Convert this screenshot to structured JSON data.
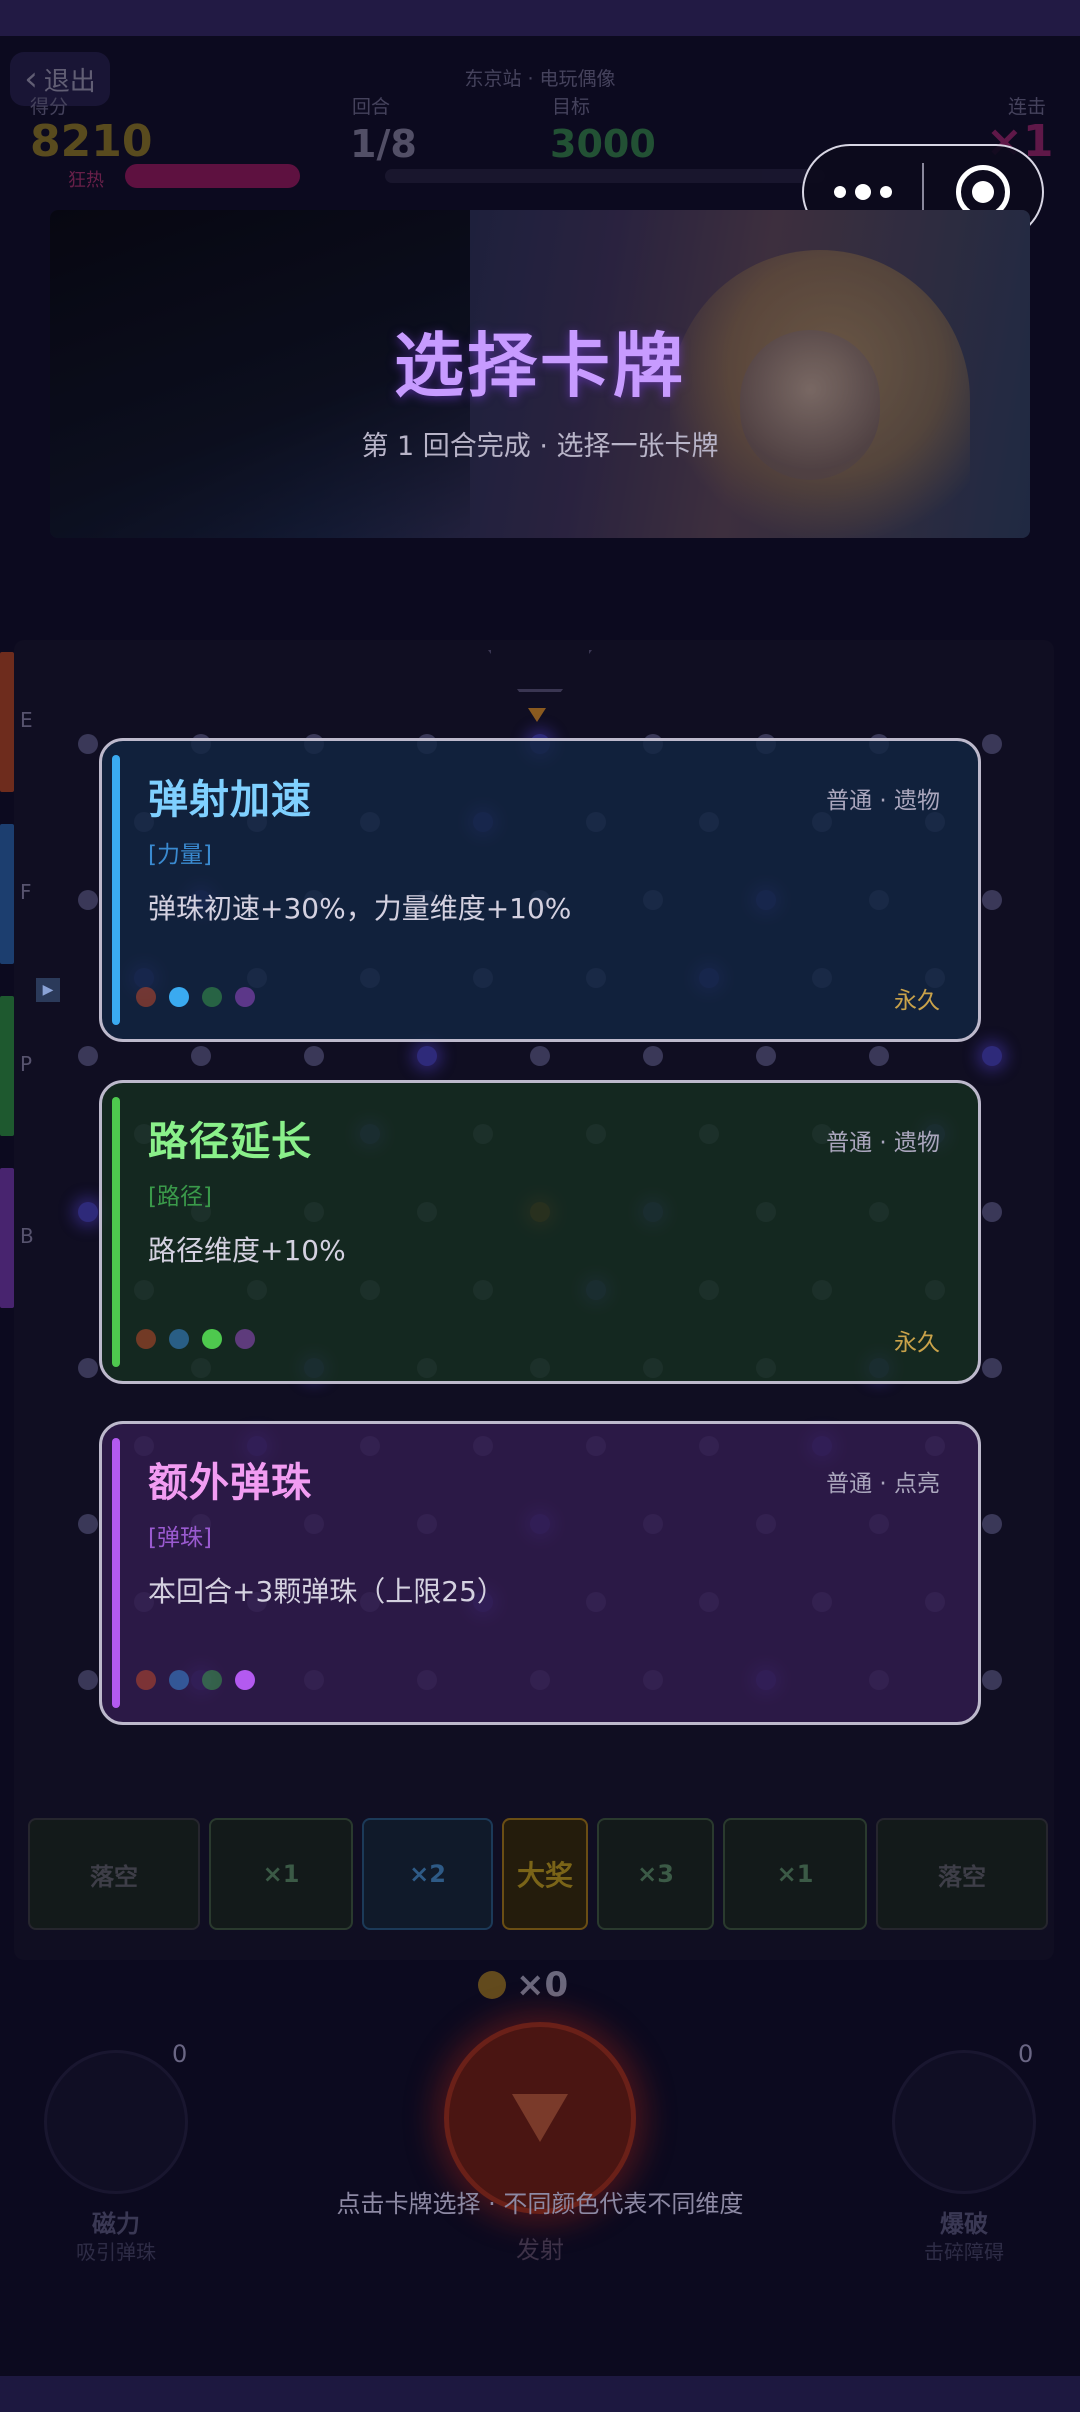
{
  "hud": {
    "exit_label": "退出",
    "stage": "东京站 · 电玩偶像",
    "score_label": "得分",
    "score_value": "8210",
    "round_label": "回合",
    "round_value": "1/8",
    "target_label": "目标",
    "target_value": "3000",
    "combo_label": "连击",
    "combo_value": "×1",
    "heat_label": "狂热",
    "heat_progress": 0.25
  },
  "banner": {
    "title": "选择卡牌",
    "subtitle": "第 1 回合完成  ·  选择一张卡牌"
  },
  "side": {
    "letters": [
      "E",
      "F",
      "P",
      "B"
    ],
    "colors": [
      "#c0481c",
      "#2a6ab0",
      "#2e9a3c",
      "#7a3ab0"
    ]
  },
  "cards": [
    {
      "title": "弹射加速",
      "rarity": "普通 · 遗物",
      "tag": "[力量]",
      "desc": "弹珠初速+30%，力量维度+10%",
      "duration": "永久",
      "accent": "#3aaaf0",
      "title_color": "#7fd0ff",
      "active_dot": 1
    },
    {
      "title": "路径延长",
      "rarity": "普通 · 遗物",
      "tag": "[路径]",
      "desc": "路径维度+10%",
      "duration": "永久",
      "accent": "#4ec94e",
      "title_color": "#8af08a",
      "active_dot": 2
    },
    {
      "title": "额外弹珠",
      "rarity": "普通 · 点亮",
      "tag": "[弹珠]",
      "desc": "本回合+3颗弹珠（上限25）",
      "duration": "",
      "accent": "#b35af0",
      "title_color": "#f29cf2",
      "active_dot": 3
    }
  ],
  "dim_colors": {
    "tag_colors": [
      "#3a8ad0",
      "#3a9a4a",
      "#9a5ad0"
    ],
    "dot_colors": [
      "#c0482a",
      "#3a8ad8",
      "#3a9a4a",
      "#9a4ac8"
    ]
  },
  "slots": [
    "落空",
    "×1",
    "×2",
    "大奖",
    "×3",
    "×1",
    "落空"
  ],
  "coins": "×0",
  "skills": {
    "left_label": "磁力",
    "left_sub": "吸引弹珠",
    "left_count": "0",
    "right_label": "爆破",
    "right_sub": "击碎障碍",
    "right_count": "0",
    "fire_label": "发射"
  },
  "hint": "点击卡牌选择  ·  不同颜色代表不同维度"
}
